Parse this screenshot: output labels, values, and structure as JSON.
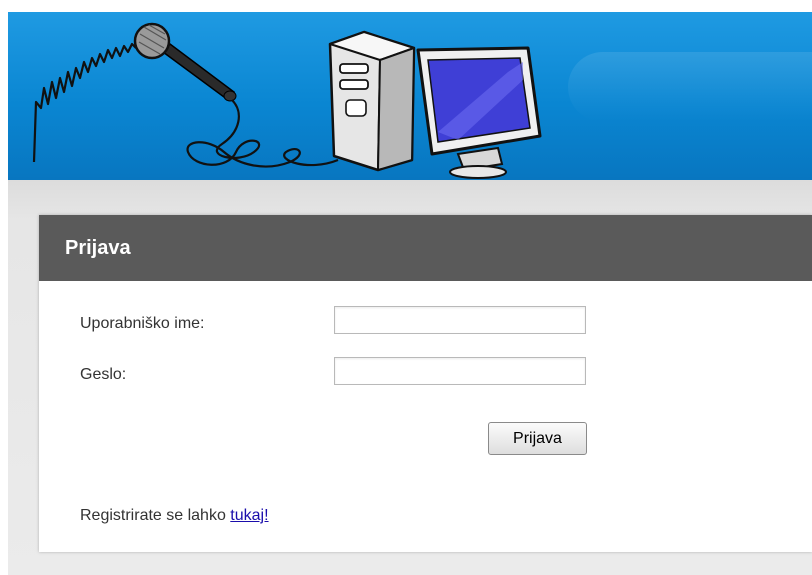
{
  "banner": {
    "icons": [
      "microphone-icon",
      "computer-tower-icon",
      "monitor-icon",
      "sound-wave-icon"
    ],
    "colors": {
      "sky": "#0a86d2",
      "sky_light": "#1f9ae2",
      "monitor_screen": "#3f3fd6"
    }
  },
  "login": {
    "title": "Prijava",
    "username_label": "Uporabniško ime:",
    "username_value": "",
    "password_label": "Geslo:",
    "password_value": "",
    "submit_label": "Prijava",
    "register_text": "Registrirate se lahko",
    "register_link": "tukaj!"
  },
  "colors": {
    "panel_header": "#5a5a5a",
    "page_bg": "#e6e6e6",
    "link": "#1a0dab"
  }
}
